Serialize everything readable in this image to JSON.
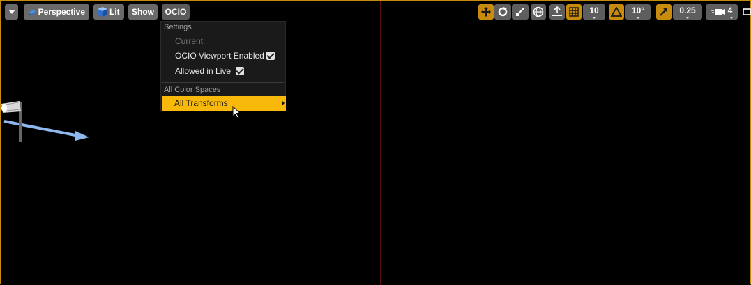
{
  "toolbar": {
    "perspective_label": "Perspective",
    "lit_label": "Lit",
    "show_label": "Show",
    "ocio_label": "OCIO"
  },
  "ocio_menu": {
    "settings_header": "Settings",
    "current_label": "Current:",
    "viewport_enabled_label": "OCIO Viewport Enabled",
    "viewport_enabled_checked": true,
    "allowed_in_live_label": "Allowed in Live",
    "allowed_in_live_checked": true,
    "color_spaces_header": "All Color Spaces",
    "all_transforms_label": "All Transforms"
  },
  "right_toolbar": {
    "grid_snap_value": "10",
    "rotation_snap_value": "10°",
    "scale_snap_value": "0.25",
    "camera_speed_value": "4"
  },
  "colors": {
    "accent": "#f8b90a",
    "active_button": "#c98b0b",
    "button_bg": "#6a6a6a",
    "menu_bg": "#1a1a1a"
  }
}
